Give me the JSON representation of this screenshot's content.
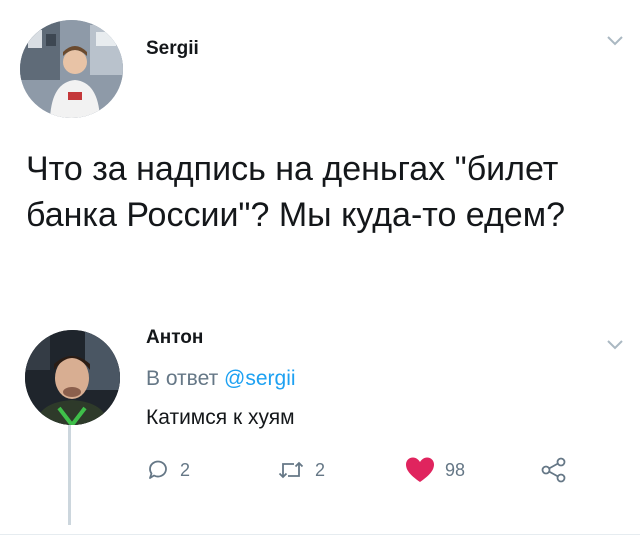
{
  "tweet": {
    "author": "Sergii",
    "text": "Что за надпись на деньгах \"билет банка России\"? Мы куда-то едем?"
  },
  "reply": {
    "author": "Антон",
    "reply_prefix": "В ответ ",
    "reply_handle": "@sergii",
    "text": "Катимся к хуям",
    "actions": {
      "replies": "2",
      "retweets": "2",
      "likes": "98"
    }
  },
  "colors": {
    "like": "#e0245e",
    "link": "#1da1f2",
    "muted": "#657786"
  }
}
